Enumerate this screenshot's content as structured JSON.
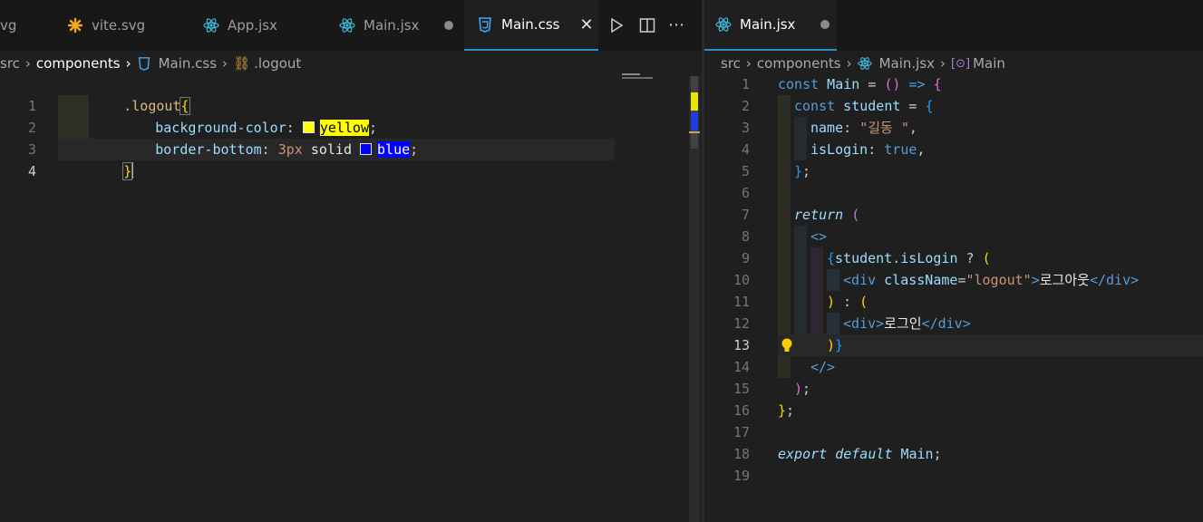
{
  "left": {
    "tabs": [
      {
        "label": "vg",
        "icon": "none"
      },
      {
        "label": "vite.svg",
        "icon": "vite-asterisk-icon"
      },
      {
        "label": "App.jsx",
        "icon": "react-icon"
      },
      {
        "label": "Main.jsx",
        "icon": "react-icon"
      },
      {
        "label": "Main.css",
        "icon": "css-icon"
      }
    ],
    "actions": [
      "run-icon",
      "split-editor-icon",
      "more-actions-icon"
    ],
    "breadcrumb": {
      "src": "src",
      "components": "components",
      "file": "Main.css",
      "symbol": ".logout"
    },
    "lines": [
      "1",
      "2",
      "3",
      "4"
    ],
    "code": {
      "l1_selector": ".logout",
      "l1_brace": "{",
      "l2_prop": "background-color",
      "l2_colon": ": ",
      "l2_value": "yellow",
      "l2_semi": ";",
      "l3_prop": "border-bottom",
      "l3_colon": ": ",
      "l3_num": "3px",
      "l3_solid": " solid ",
      "l3_value": "blue",
      "l3_semi": ";",
      "l4_brace": "}"
    },
    "colors": {
      "swatch_yellow": "#ffff00",
      "swatch_blue": "#0000ff"
    }
  },
  "right": {
    "tab": {
      "label": "Main.jsx",
      "icon": "react-icon"
    },
    "breadcrumb": {
      "src": "src",
      "components": "components",
      "file": "Main.jsx",
      "symbol": "Main"
    },
    "lines": [
      "1",
      "2",
      "3",
      "4",
      "5",
      "6",
      "7",
      "8",
      "9",
      "10",
      "11",
      "12",
      "13",
      "14",
      "15",
      "16",
      "17",
      "18",
      "19"
    ],
    "current_line": "13",
    "code": {
      "l1": [
        "const",
        " Main",
        " = ",
        "()",
        " => ",
        "{"
      ],
      "l2": [
        "const",
        " student",
        " = ",
        "{"
      ],
      "l3": [
        "name",
        ": ",
        "\"길동 \"",
        ","
      ],
      "l4": [
        "isLogin",
        ": ",
        "true",
        ","
      ],
      "l5": [
        "}",
        ";"
      ],
      "l7": [
        "return",
        " ",
        "("
      ],
      "l8": [
        "<>"
      ],
      "l9": [
        "{",
        "student",
        ".",
        "isLogin",
        " ? ",
        "("
      ],
      "l10": [
        "<",
        "div",
        " ",
        "className",
        "=",
        "\"logout\"",
        ">",
        "로그아웃",
        "</",
        "div",
        ">"
      ],
      "l11": [
        ")",
        " : ",
        "("
      ],
      "l12": [
        "<",
        "div",
        ">",
        "로그인",
        "</",
        "div",
        ">"
      ],
      "l13": [
        ")",
        "}"
      ],
      "l14": [
        "</>"
      ],
      "l15": [
        ")",
        ";"
      ],
      "l16": [
        "}",
        ";"
      ],
      "l18": [
        "export",
        " ",
        "default",
        " ",
        "Main",
        ";"
      ]
    }
  }
}
